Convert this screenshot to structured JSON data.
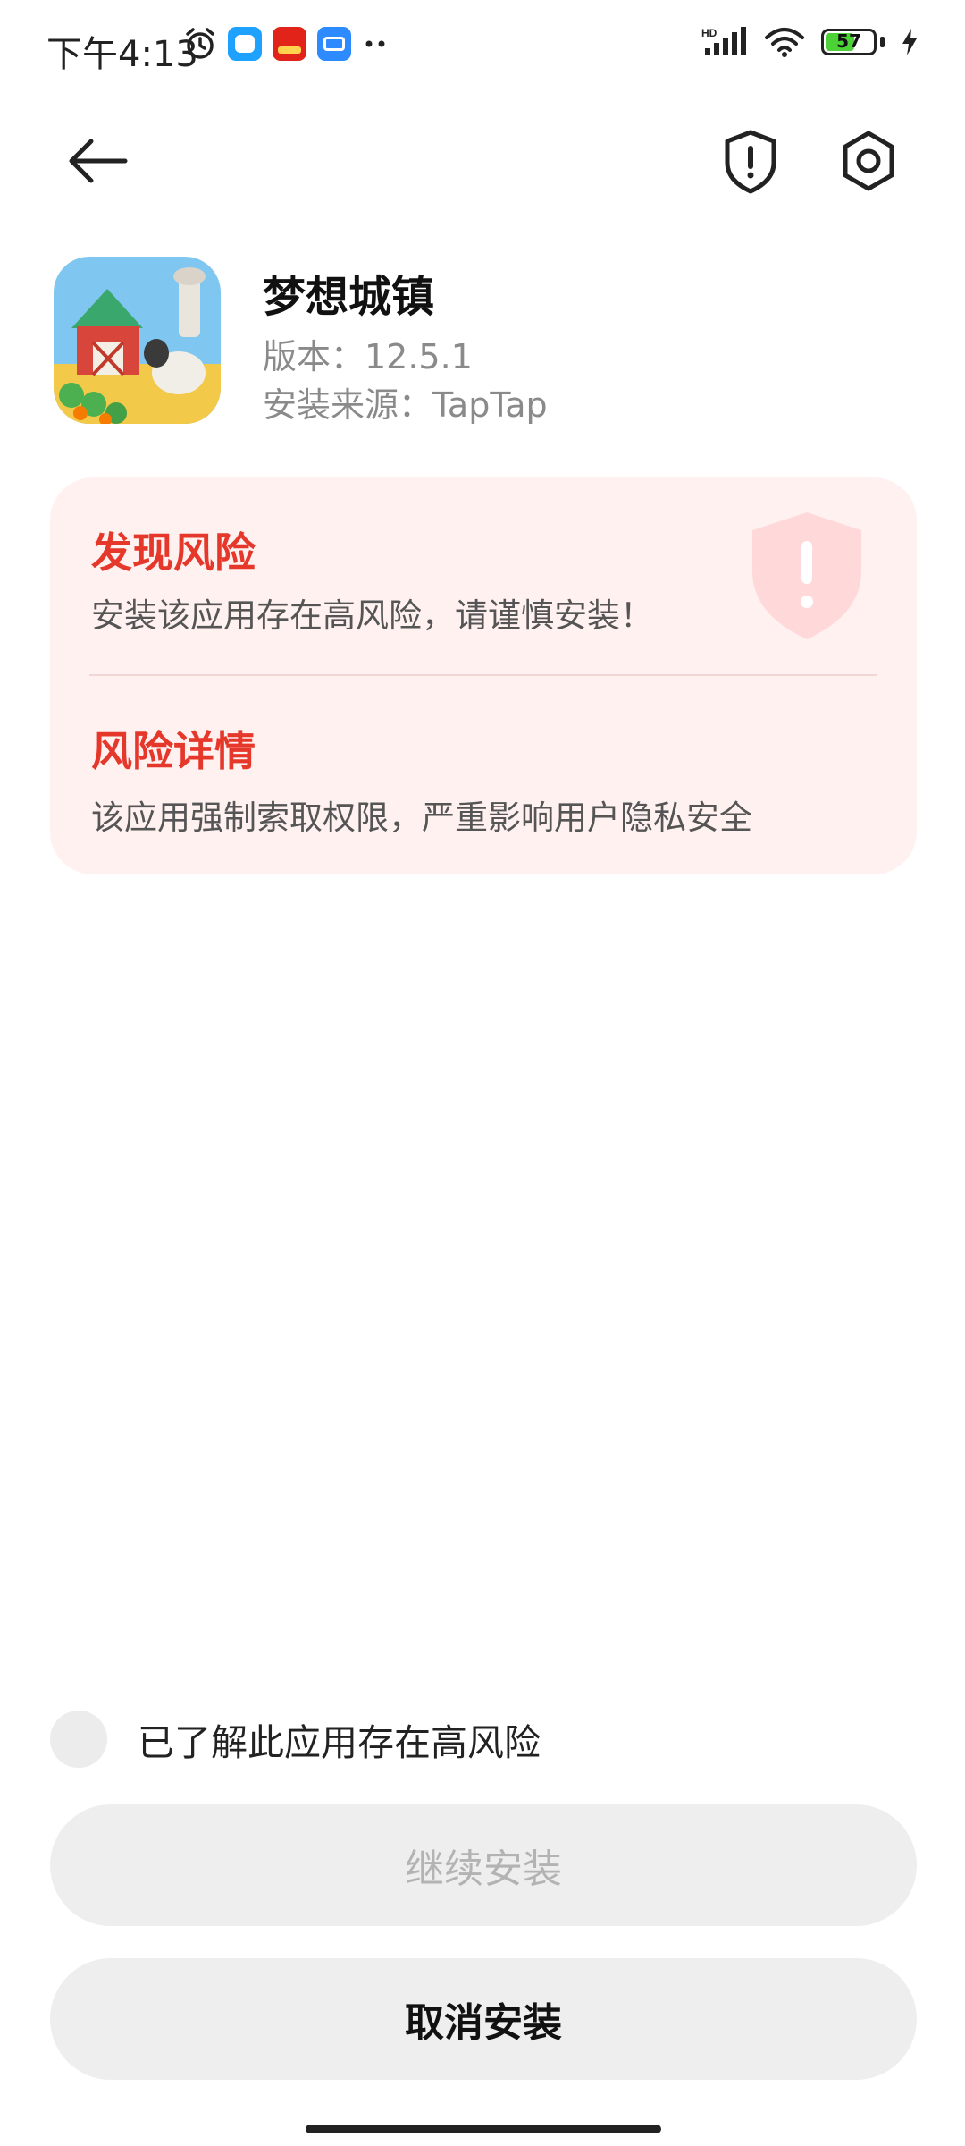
{
  "status_bar": {
    "time": "下午4:13",
    "network_label": "HD",
    "battery_level": "57"
  },
  "app": {
    "name": "梦想城镇",
    "version": "版本：12.5.1",
    "source": "安装来源：TapTap"
  },
  "risk": {
    "title": "发现风险",
    "description": "安装该应用存在高风险，请谨慎安装！",
    "detail_title": "风险详情",
    "detail_description": "该应用强制索取权限，严重影响用户隐私安全"
  },
  "actions": {
    "acknowledge_label": "已了解此应用存在高风险",
    "acknowledge_checked": false,
    "continue_label": "继续安装",
    "cancel_label": "取消安装"
  },
  "colors": {
    "accent_red": "#e5382b",
    "card_bg": "#fff1f0",
    "button_bg": "#eeeeee"
  },
  "icons": {
    "back": "arrow-left-icon",
    "security": "shield-exclamation-icon",
    "settings": "gear-icon",
    "card_watermark": "shield-warning-icon"
  }
}
